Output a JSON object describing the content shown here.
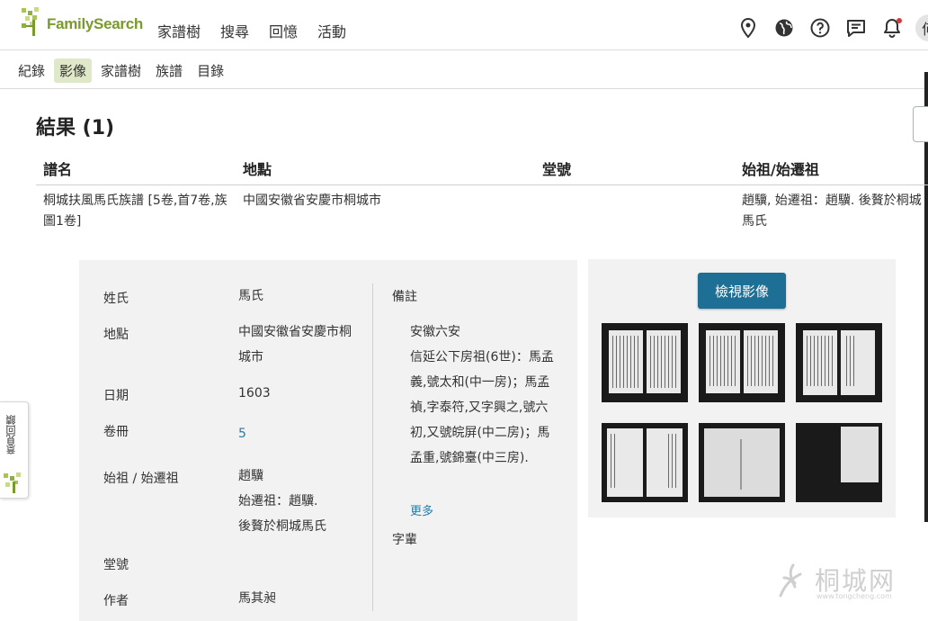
{
  "header": {
    "logo_text": "FamilySearch",
    "nav": [
      "家譜樹",
      "搜尋",
      "回憶",
      "活動"
    ],
    "icons": [
      "location-pin-icon",
      "globe-icon",
      "help-icon",
      "messages-icon",
      "notifications-icon"
    ],
    "avatar_text": "何"
  },
  "subnav": {
    "items": [
      "紀錄",
      "影像",
      "家譜樹",
      "族譜",
      "目錄"
    ],
    "active": "影像"
  },
  "results": {
    "title": "結果 (1)",
    "columns": [
      "譜名",
      "地點",
      "堂號",
      "始祖/始遷祖"
    ],
    "row": {
      "name": "桐城扶風馬氏族譜 [5卷,首7卷,族圖1卷]",
      "place": "中國安徽省安慶市桐城市",
      "hall": "",
      "ancestor": "趙驥, 始遷祖：趙驥. 後贅於桐城馬氏"
    }
  },
  "detail": {
    "surname_label": "姓氏",
    "surname": "馬氏",
    "place_label": "地點",
    "place": "中國安徽省安慶市桐城市",
    "date_label": "日期",
    "date": "1603",
    "volumes_label": "卷冊",
    "volumes": "5",
    "ancestor_label": "始祖 / 始遷祖",
    "ancestor_line1": "趙驥",
    "ancestor_line2": "始遷祖：趙驥.",
    "ancestor_line3": "後贅於桐城馬氏",
    "hall_label": "堂號",
    "author_label": "作者",
    "author": "馬其昶",
    "notes_label": "備註",
    "notes": "安徽六安\n信延公下房祖(6世)：馬孟義,號太和(中一房)；馬孟禎,字泰符,又字興之,號六初,又號皖屏(中二房)；馬孟重,號錦臺(中三房).",
    "more_link": "更多",
    "generation_label": "字輩"
  },
  "images": {
    "view_button": "檢視影像",
    "thumbnail_count": 6
  },
  "feedback": {
    "label": "意見回饋"
  },
  "watermark": {
    "text": "桐城网",
    "sub": "www.tongcheng.com"
  }
}
